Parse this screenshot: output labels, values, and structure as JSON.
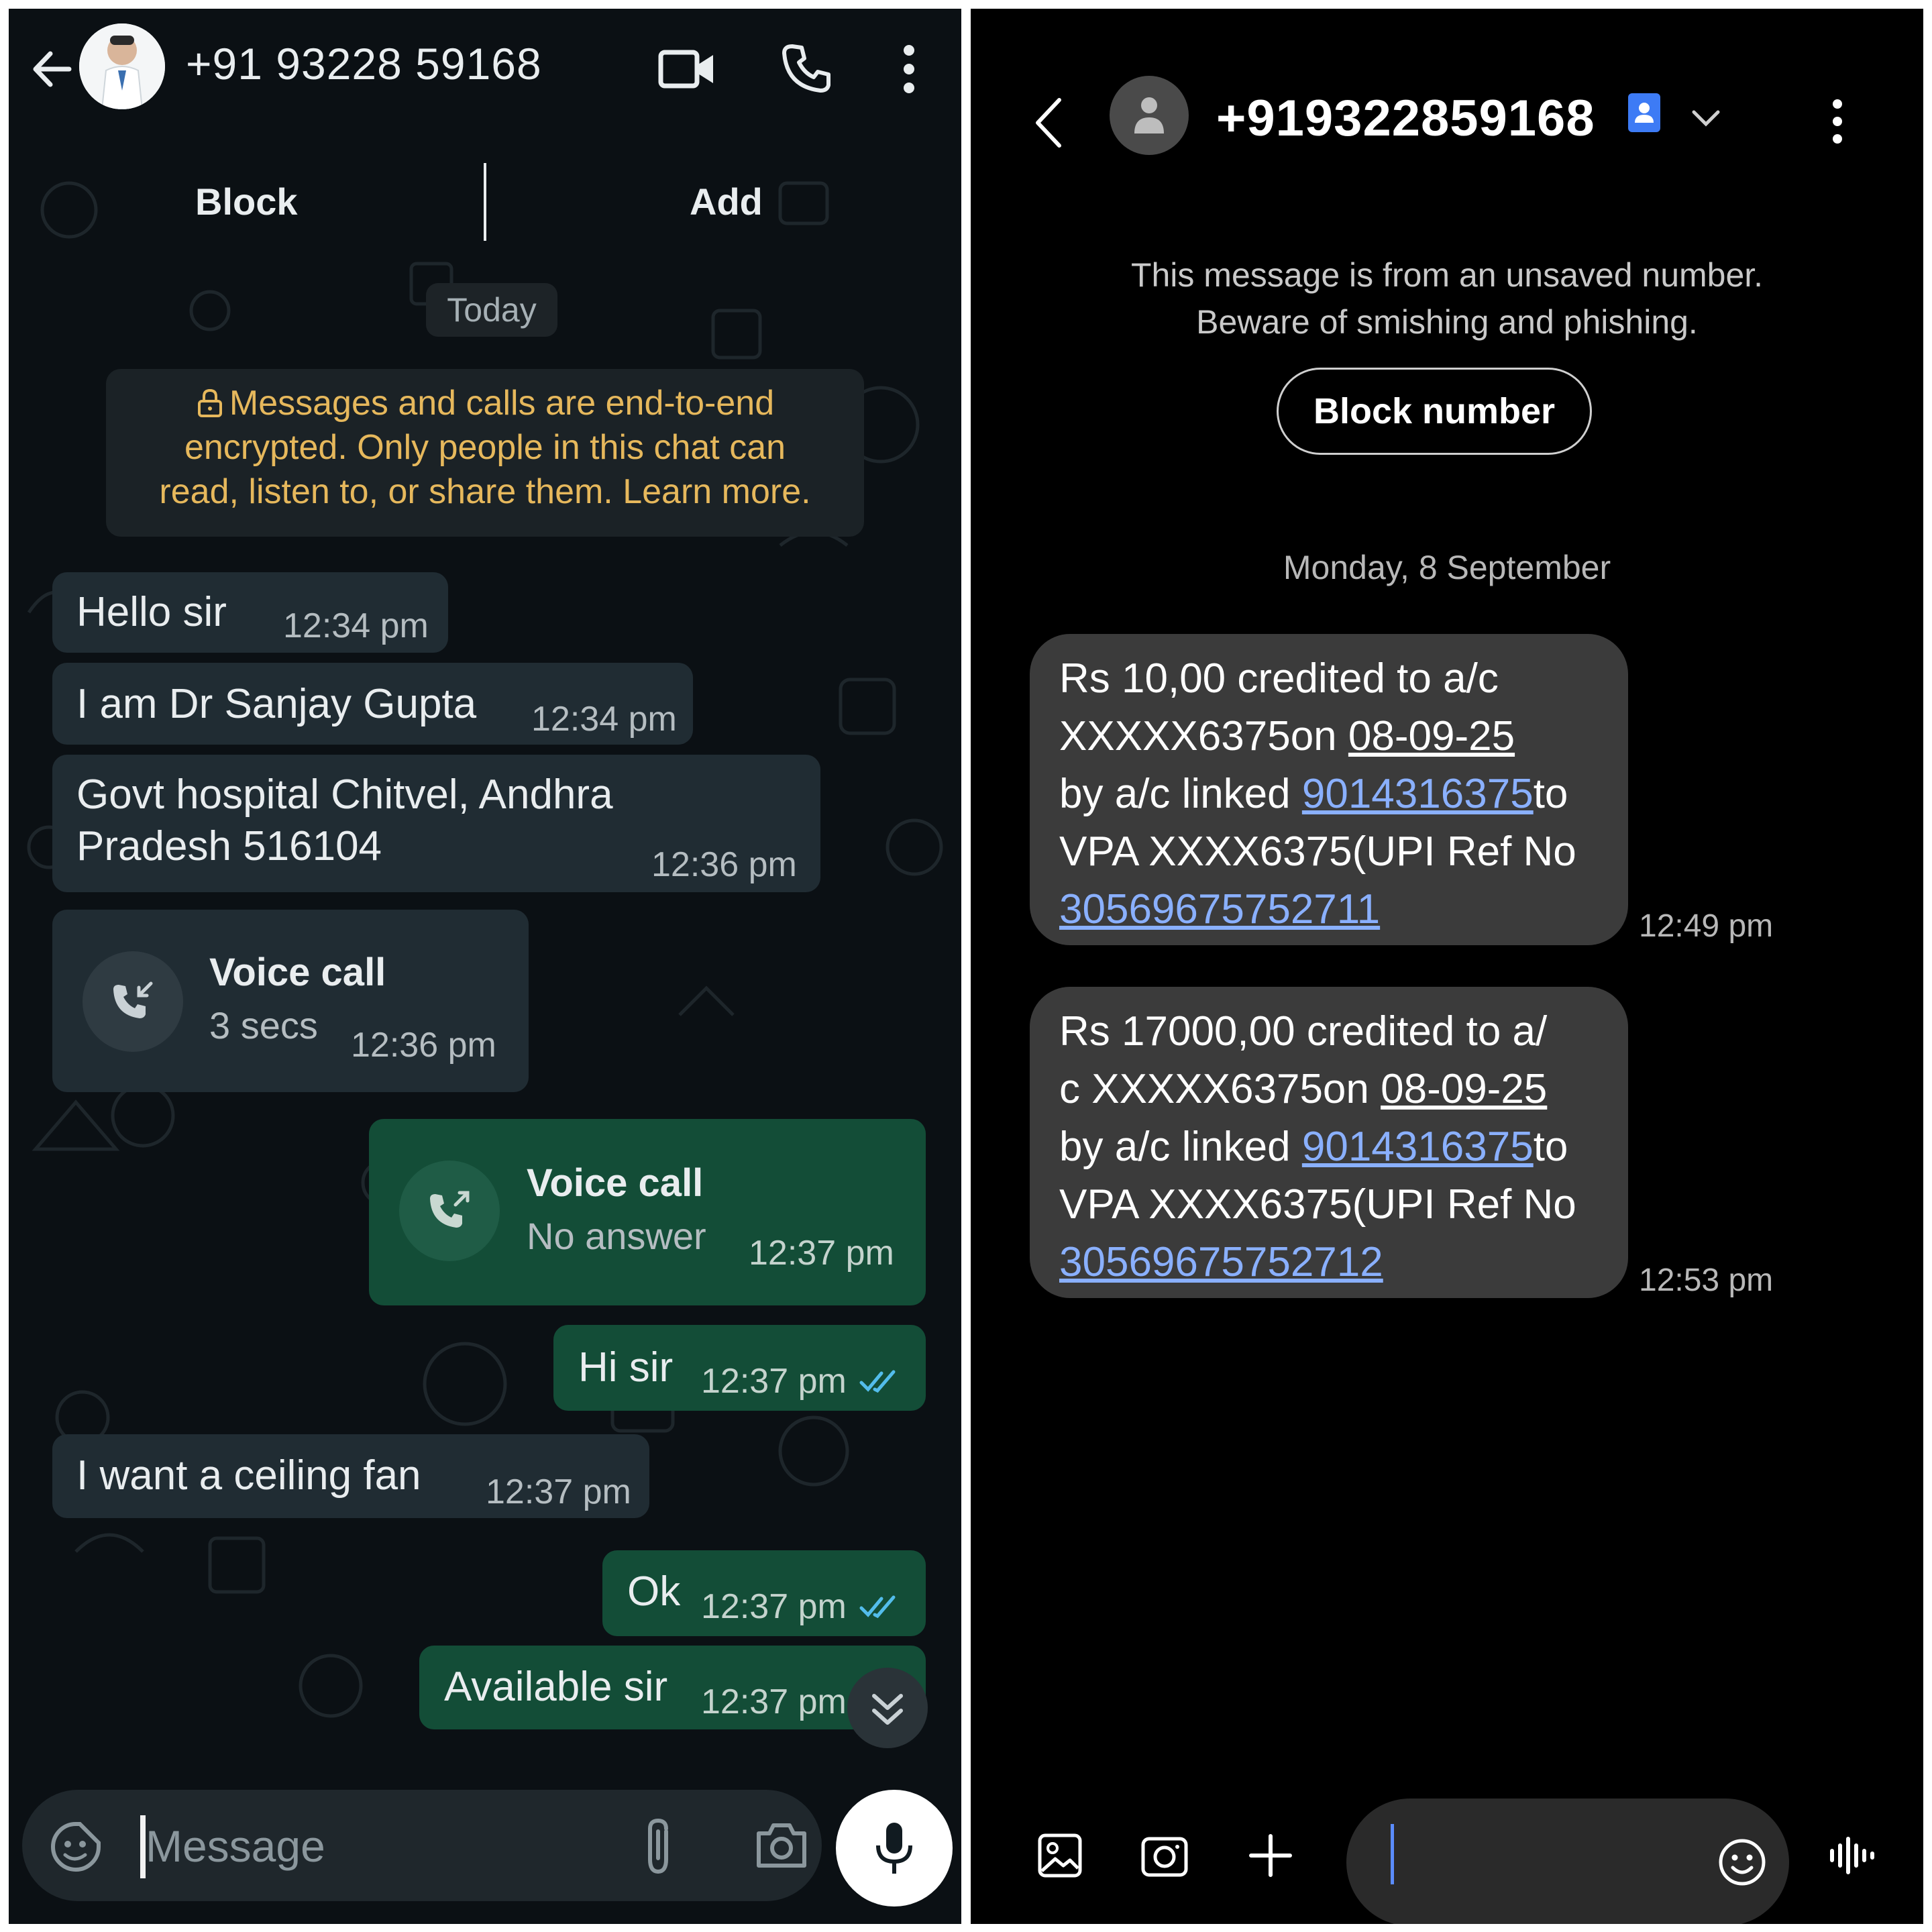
{
  "whatsapp": {
    "contact_name": "+91 93228 59168",
    "actions": {
      "block_label": "Block",
      "add_label": "Add"
    },
    "date_chip": "Today",
    "encryption_notice": {
      "line1": "Messages and calls are end-to-end",
      "line2": "encrypted. Only people in this chat can",
      "line3": "read, listen to, or share them. Learn more."
    },
    "messages": [
      {
        "text": "Hello sir",
        "time": "12:34 pm"
      },
      {
        "text": "I am Dr Sanjay Gupta",
        "time": "12:34 pm"
      },
      {
        "line1": "Govt hospital  Chitvel, Andhra",
        "line2": "Pradesh 516104",
        "time": "12:36 pm"
      },
      {
        "title": "Voice call",
        "subtitle": "3 secs",
        "time": "12:36 pm"
      },
      {
        "title": "Voice call",
        "subtitle": "No answer",
        "time": "12:37 pm"
      },
      {
        "text": "Hi sir",
        "time": "12:37 pm"
      },
      {
        "text": "I want a ceiling fan",
        "time": "12:37 pm"
      },
      {
        "text": "Ok",
        "time": "12:37 pm"
      },
      {
        "text": "Available sir",
        "time": "12:37 pm"
      }
    ],
    "composer": {
      "placeholder": "Message"
    },
    "icons": [
      "back-arrow-icon",
      "video-call-icon",
      "phone-icon",
      "more-vert-icon",
      "lock-icon",
      "incoming-call-icon",
      "outgoing-call-icon",
      "double-check-icon",
      "scroll-down-icon",
      "sticker-icon",
      "attach-icon",
      "camera-icon",
      "mic-icon"
    ],
    "colors": {
      "background": "#0b1014",
      "incoming_bubble": "#202c33",
      "outgoing_bubble": "#134d37",
      "notice_text": "#e6b85c",
      "read_tick": "#53bdeb"
    }
  },
  "sms": {
    "contact_name": "+919322859168",
    "warning": {
      "line1": "This message is from an unsaved number.",
      "line2": "Beware of smishing and phishing."
    },
    "block_button": "Block number",
    "date_header": "Monday, 8 September",
    "messages": [
      {
        "l1": "Rs 10,00 credited to a/c",
        "l2a": "XXXXX6375on ",
        "l2b": "08-09-25",
        "l3a": "by a/c linked ",
        "l3b": "9014316375",
        "l3c": "to",
        "l4": "VPA XXXX6375(UPI Ref No",
        "l5": "30569675752711",
        "time": "12:49 pm"
      },
      {
        "l1": "Rs 17000,00 credited to a/",
        "l2a": "c XXXXX6375on ",
        "l2b": "08-09-25",
        "l3a": "by a/c linked ",
        "l3b": "9014316375",
        "l3c": "to",
        "l4": "VPA XXXX6375(UPI Ref No",
        "l5": "30569675752712",
        "time": "12:53 pm"
      }
    ],
    "icons": [
      "back-chevron-icon",
      "contact-card-icon",
      "chevron-down-icon",
      "more-vert-icon",
      "gallery-icon",
      "camera-icon",
      "plus-icon",
      "emoji-icon",
      "voice-wave-icon"
    ],
    "colors": {
      "background": "#000000",
      "bubble": "#3b3b3b",
      "link": "#8ab0ff"
    }
  }
}
